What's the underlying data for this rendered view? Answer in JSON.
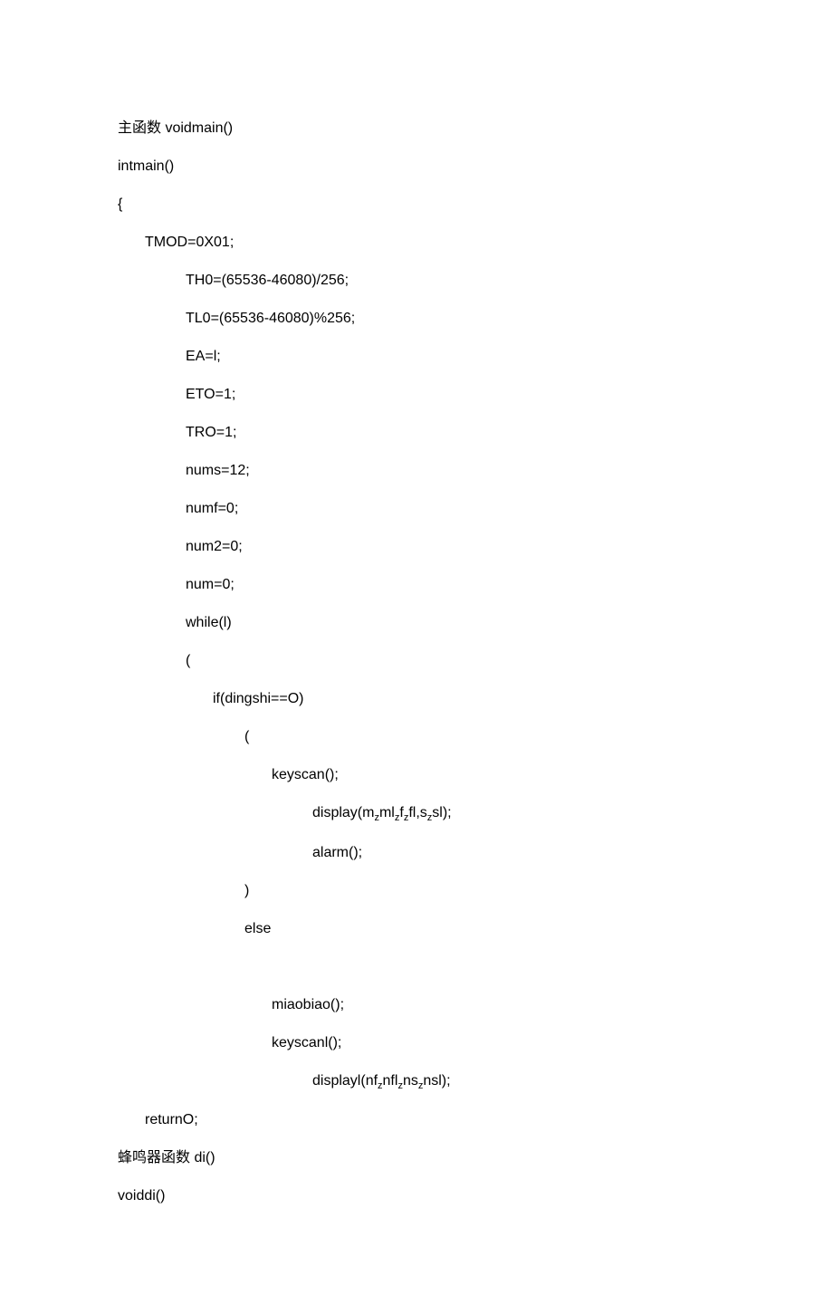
{
  "lines": [
    {
      "indent": 0,
      "text": "主函数 voidmain()"
    },
    {
      "indent": 0,
      "text": "intmain()"
    },
    {
      "indent": 0,
      "text": "{"
    },
    {
      "indent": 1,
      "text": "TMOD=0X01;"
    },
    {
      "indent": 2,
      "text": "TH0=(65536-46080)/256;"
    },
    {
      "indent": 2,
      "text": "TL0=(65536-46080)%256;"
    },
    {
      "indent": 2,
      "text": "EA=l;"
    },
    {
      "indent": 2,
      "text": "ETO=1;"
    },
    {
      "indent": 2,
      "text": "TRO=1;"
    },
    {
      "indent": 2,
      "text": "nums=12;"
    },
    {
      "indent": 2,
      "text": "numf=0;"
    },
    {
      "indent": 2,
      "text": "num2=0;"
    },
    {
      "indent": 2,
      "text": "num=0;"
    },
    {
      "indent": 2,
      "text": "while(l)"
    },
    {
      "indent": 2,
      "text": "("
    },
    {
      "indent": 3,
      "text": "if(dingshi==O)"
    },
    {
      "indent": 4,
      "text": "("
    },
    {
      "indent": 5,
      "text": "keyscan();"
    },
    {
      "indent": 6,
      "html": "display(m<span class=\"sub\">z</span>ml<span class=\"sub\">z</span>f<span class=\"sub\">z</span>fl,s<span class=\"sub\">z</span>sl);"
    },
    {
      "indent": 6,
      "text": "alarm();"
    },
    {
      "indent": 4,
      "text": ")"
    },
    {
      "indent": 4,
      "text": "else"
    },
    {
      "indent": 0,
      "text": ""
    },
    {
      "indent": 5,
      "text": "miaobiao();"
    },
    {
      "indent": 5,
      "text": "keyscanl();"
    },
    {
      "indent": 6,
      "html": "displayl(nf<span class=\"sub\">z</span>nfl<span class=\"sub\">z</span>ns<span class=\"sub\">z</span>nsl);"
    },
    {
      "indent": 1,
      "text": "returnO;"
    },
    {
      "indent": 0,
      "text": "蜂鸣器函数 di()"
    },
    {
      "indent": 0,
      "text": "voiddi()"
    }
  ],
  "indent_map": {
    "0": 0,
    "1": 30,
    "2": 75,
    "3": 105,
    "4": 140,
    "5": 170,
    "6": 215
  }
}
